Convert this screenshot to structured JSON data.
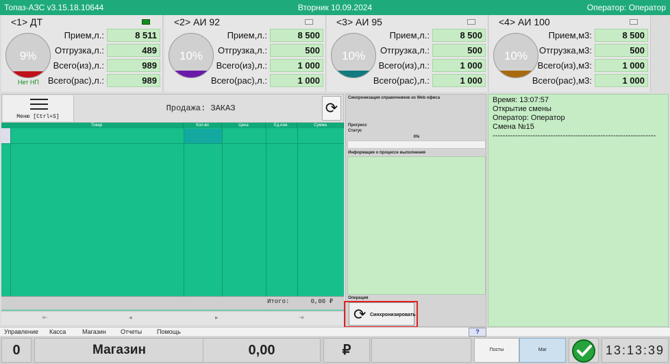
{
  "titlebar": {
    "app": "Топаз-АЗС  v3.15.18.10644",
    "date": "Вторник 10.09.2024",
    "operator": "Оператор: Оператор"
  },
  "dispensers": [
    {
      "name": "<1> ДТ",
      "percent": "9%",
      "fill_fraction": 0.09,
      "fill_color": "#c0101a",
      "indicator_on": true,
      "note": "Нет НП",
      "rows": [
        {
          "label": "Прием,л.:",
          "value": "8 511"
        },
        {
          "label": "Отгрузка,л.:",
          "value": "489"
        },
        {
          "label": "Всего(из),л.:",
          "value": "989"
        },
        {
          "label": "Всего(рас),л.:",
          "value": "989"
        }
      ]
    },
    {
      "name": "<2> АИ 92",
      "percent": "10%",
      "fill_fraction": 0.1,
      "fill_color": "#6a1aa8",
      "indicator_on": false,
      "note": "",
      "rows": [
        {
          "label": "Прием,л.:",
          "value": "8 500"
        },
        {
          "label": "Отгрузка,л.:",
          "value": "500"
        },
        {
          "label": "Всего(из),л.:",
          "value": "1 000"
        },
        {
          "label": "Всего(рас),л.:",
          "value": "1 000"
        }
      ]
    },
    {
      "name": "<3> АИ 95",
      "percent": "10%",
      "fill_fraction": 0.1,
      "fill_color": "#137a80",
      "indicator_on": false,
      "note": "",
      "rows": [
        {
          "label": "Прием,л.:",
          "value": "8 500"
        },
        {
          "label": "Отгрузка,л.:",
          "value": "500"
        },
        {
          "label": "Всего(из),л.:",
          "value": "1 000"
        },
        {
          "label": "Всего(рас),л.:",
          "value": "1 000"
        }
      ]
    },
    {
      "name": "<4> АИ 100",
      "percent": "10%",
      "fill_fraction": 0.1,
      "fill_color": "#a86a10",
      "indicator_on": false,
      "note": "",
      "rows": [
        {
          "label": "Прием,м3:",
          "value": "8 500"
        },
        {
          "label": "Отгрузка,м3:",
          "value": "500"
        },
        {
          "label": "Всего(из),м3:",
          "value": "1 000"
        },
        {
          "label": "Всего(рас),м3:",
          "value": "1 000"
        }
      ]
    }
  ],
  "order": {
    "menu_label": "Меню [Ctrl+S]",
    "title": "Продажа: ЗАКАЗ",
    "columns": [
      "Товар",
      "Кол-во",
      "Цена",
      "Ед.изм.",
      "Сумма"
    ],
    "total_label": "Итого:",
    "total_value": "0,00 ₽",
    "nav": [
      "⇤",
      "◂",
      "▸",
      "⇥"
    ]
  },
  "sync": {
    "title": "Синхронизация справочников из Web офиса",
    "progress_label": "Прогресс",
    "status_label": "Статус",
    "progress_text": "0%",
    "progress_value": 0,
    "info_label": "Информация о процессе выполнения",
    "operation_label": "Операция",
    "button_label": "Синхронизировать"
  },
  "journal": {
    "lines": [
      "   Время: 13:07:57",
      "Открытие смены",
      "Оператор: Оператор",
      "Смена №15",
      "-----------------------------------------------------------------"
    ]
  },
  "menus": [
    "Управление",
    "Касса",
    "Магазин",
    "Отчеты",
    "Помощь"
  ],
  "help_label": "?",
  "bottom": {
    "number": "0",
    "mode": "Магазин",
    "amount": "0,00",
    "currency": "₽",
    "posts_label": "Посты",
    "shop_label": "Маг",
    "clock": "13:13:39"
  },
  "colors": {
    "accent": "#1eaa7a",
    "grid": "#17bf8a",
    "panel_green": "#c6ecc6",
    "ok": "#27a33c",
    "highlight": "#e02020"
  },
  "icons": {
    "menu": "hamburger-icon",
    "refresh": "refresh-icon",
    "sync": "sync-icon",
    "ok": "checkmark-icon"
  }
}
